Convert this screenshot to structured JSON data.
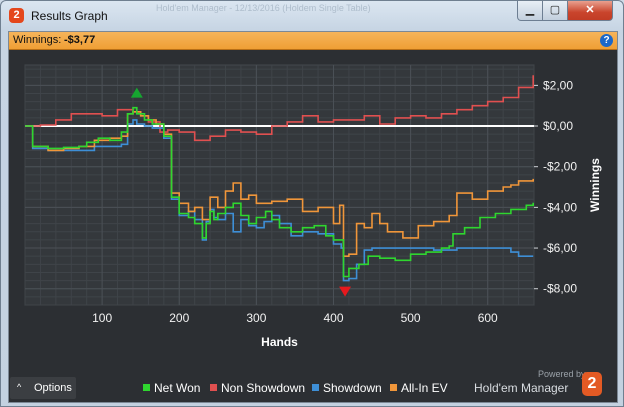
{
  "window": {
    "title": "Results Graph",
    "background_title": "Hold'em Manager - 12/13/2016 (Holdem Single Table)",
    "app_logo_text": "2",
    "buttons": {
      "minimize": "▁",
      "maximize": "▢",
      "close": "✕"
    }
  },
  "header": {
    "label": "Winnings:",
    "value": "-$3,77",
    "help_icon": "?"
  },
  "chart_data": {
    "type": "line",
    "xlabel": "Hands",
    "ylabel": "Winnings",
    "xlim": [
      0,
      660
    ],
    "ylim": [
      -8.8,
      3.0
    ],
    "x_ticks": [
      100,
      200,
      300,
      400,
      500,
      600
    ],
    "y_ticks": [
      2,
      0,
      -2,
      -4,
      -6,
      -8
    ],
    "y_tick_labels": [
      "$2,00",
      "$0,00",
      "-$2,00",
      "-$4,00",
      "-$6,00",
      "-$8,00"
    ],
    "grid": true,
    "zero_line": true,
    "legend_position": "bottom",
    "markers": [
      {
        "kind": "max",
        "x": 145,
        "y": 1.2,
        "color": "#16a630"
      },
      {
        "kind": "min",
        "x": 415,
        "y": -7.7,
        "color": "#e6191e"
      }
    ],
    "series": [
      {
        "name": "Net Won",
        "color": "#2fd62f",
        "x": [
          0,
          10,
          30,
          50,
          70,
          80,
          95,
          110,
          125,
          133,
          140,
          145,
          155,
          165,
          180,
          190,
          200,
          212,
          220,
          230,
          235,
          240,
          245,
          250,
          260,
          270,
          280,
          290,
          300,
          312,
          320,
          330,
          345,
          360,
          375,
          390,
          400,
          410,
          413,
          420,
          433,
          445,
          460,
          480,
          500,
          520,
          540,
          550,
          555,
          570,
          590,
          610,
          630,
          650,
          659
        ],
        "y": [
          0,
          -1,
          -1.1,
          -1.05,
          -1,
          -0.8,
          -0.6,
          -0.7,
          -0.3,
          0.6,
          0.9,
          0.6,
          0.3,
          0.1,
          -0.5,
          -3.5,
          -4.3,
          -4.5,
          -4.8,
          -5.5,
          -4.8,
          -4.2,
          -4.6,
          -4.3,
          -4,
          -3.8,
          -4.4,
          -4.8,
          -4.5,
          -4.2,
          -4.6,
          -5,
          -5.2,
          -5,
          -4.9,
          -5.4,
          -5.6,
          -5.6,
          -7.4,
          -7,
          -6.8,
          -6.4,
          -6.5,
          -6.6,
          -6.3,
          -6.2,
          -6,
          -5.9,
          -5.3,
          -5,
          -4.5,
          -4.3,
          -4.1,
          -3.9,
          -3.77
        ]
      },
      {
        "name": "Non Showdown",
        "color": "#e05050",
        "x": [
          0,
          20,
          40,
          60,
          80,
          100,
          120,
          133,
          140,
          150,
          160,
          175,
          185,
          200,
          220,
          240,
          260,
          280,
          300,
          320,
          340,
          360,
          380,
          400,
          420,
          440,
          460,
          480,
          500,
          520,
          540,
          560,
          580,
          600,
          620,
          640,
          659
        ],
        "y": [
          0,
          0.05,
          0.3,
          0.6,
          0.6,
          0.5,
          0.8,
          0.8,
          0.7,
          0.5,
          0.2,
          -0.3,
          -0.2,
          -0.3,
          -0.7,
          -0.5,
          -0.2,
          -0.3,
          -0.4,
          0,
          0.2,
          0.5,
          0.2,
          0.3,
          0.3,
          0.5,
          0.1,
          0.4,
          0.5,
          0.4,
          0.6,
          0.8,
          1.0,
          1.2,
          1.4,
          1.9,
          2.5
        ]
      },
      {
        "name": "Showdown",
        "color": "#3e8fd6",
        "x": [
          0,
          10,
          30,
          50,
          70,
          90,
          110,
          125,
          133,
          140,
          145,
          155,
          165,
          180,
          190,
          200,
          212,
          220,
          230,
          235,
          240,
          245,
          250,
          260,
          270,
          280,
          290,
          300,
          310,
          320,
          330,
          345,
          360,
          380,
          400,
          410,
          413,
          420,
          430,
          440,
          450,
          470,
          500,
          530,
          560,
          600,
          630,
          640,
          659
        ],
        "y": [
          0,
          -1.1,
          -1.2,
          -1.2,
          -1.2,
          -1,
          -1,
          -0.9,
          0.1,
          0.3,
          0.1,
          0,
          -0.1,
          -0.6,
          -3.6,
          -4.4,
          -4.2,
          -4.6,
          -5.6,
          -4.7,
          -4.1,
          -4.5,
          -4.6,
          -4.3,
          -5.2,
          -4.6,
          -4.9,
          -5,
          -4.7,
          -4.4,
          -4.8,
          -5.4,
          -5.2,
          -5.3,
          -5.8,
          -6.0,
          -7.6,
          -7.5,
          -6.8,
          -6.1,
          -6.0,
          -6.0,
          -6.0,
          -6.1,
          -6.0,
          -6.0,
          -6.2,
          -6.4,
          -6.4
        ]
      },
      {
        "name": "All-In EV",
        "color": "#f0963a",
        "x": [
          0,
          10,
          30,
          50,
          70,
          90,
          110,
          125,
          133,
          140,
          150,
          160,
          170,
          180,
          190,
          200,
          212,
          220,
          230,
          240,
          250,
          260,
          270,
          280,
          290,
          300,
          320,
          340,
          360,
          380,
          400,
          408,
          413,
          420,
          430,
          440,
          450,
          460,
          470,
          490,
          510,
          530,
          550,
          560,
          580,
          600,
          620,
          630,
          640,
          659
        ],
        "y": [
          0,
          -1,
          -1.2,
          -1.1,
          -1,
          -0.7,
          -0.6,
          -0.5,
          0.6,
          0.7,
          0.5,
          0.3,
          0.1,
          -0.4,
          -3.3,
          -3.8,
          -4.2,
          -4.0,
          -4.6,
          -3.5,
          -4.0,
          -3.2,
          -2.8,
          -3.6,
          -3.4,
          -3.8,
          -3.7,
          -3.6,
          -4.2,
          -4.0,
          -4.8,
          -3.9,
          -6.4,
          -6.3,
          -4.8,
          -5.0,
          -4.3,
          -4.8,
          -5.2,
          -5.5,
          -4.9,
          -4.7,
          -4.4,
          -3.3,
          -3.6,
          -3.2,
          -3.0,
          -2.9,
          -2.7,
          -2.6
        ]
      }
    ]
  },
  "footer": {
    "options_label": "Options",
    "options_icon": "^",
    "legend": [
      {
        "label": "Net Won",
        "color": "#2fd62f"
      },
      {
        "label": "Non Showdown",
        "color": "#e05050"
      },
      {
        "label": "Showdown",
        "color": "#3e8fd6"
      },
      {
        "label": "All-In EV",
        "color": "#f0963a"
      }
    ],
    "powered_by": "Powered by",
    "brand": "Hold'em Manager",
    "brand_logo": "2"
  }
}
